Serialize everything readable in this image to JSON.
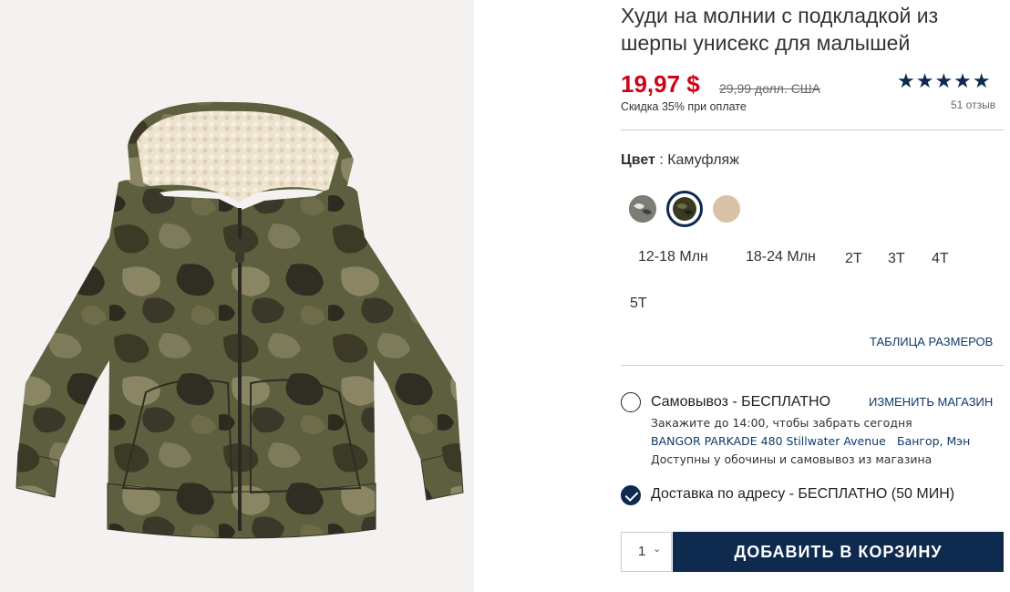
{
  "product": {
    "title": "Худи на молнии с подкладкой из шерпы унисекс для малышей",
    "price_sale": "19,97 $",
    "price_original": "29,99 долл. США",
    "discount_text": "Скидка 35% при оплате",
    "rating_stars": "★★★★★",
    "reviews_text": "51 отзыв",
    "image_icon": "camo-hoodie-image"
  },
  "color": {
    "label": "Цвет",
    "separator": " : ",
    "value": "Камуфляж",
    "swatches": [
      {
        "name": "camo-grey",
        "color": "#7a7e77"
      },
      {
        "name": "camo-olive",
        "color": "#3a3a24",
        "selected": true
      },
      {
        "name": "oatmeal",
        "color": "#d8c2a8"
      }
    ]
  },
  "sizes": [
    "12-18 Млн",
    "18-24 Млн",
    "2T",
    "3T",
    "4T",
    "5T"
  ],
  "size_chart_label": "ТАБЛИЦА РАЗМЕРОВ",
  "pickup": {
    "label": "Самовывоз - БЕСПЛАТНО",
    "change_store": "ИЗМЕНИТЬ МАГАЗИН",
    "order_by": "Закажите до 14:00, чтобы забрать сегодня",
    "store_address": "BANGOR PARKADE 480 Stillwater Avenue",
    "store_city": "Бангор, Мэн",
    "availability": "Доступны у обочины и самовывоз из магазина"
  },
  "delivery": {
    "label": "Доставка по адресу - БЕСПЛАТНО",
    "time": "(50 МИН)"
  },
  "cart": {
    "quantity": "1",
    "add_button": "ДОБАВИТЬ В КОРЗИНУ"
  },
  "colors": {
    "accent_navy": "#0e2a4f",
    "sale_red": "#d0021b"
  }
}
